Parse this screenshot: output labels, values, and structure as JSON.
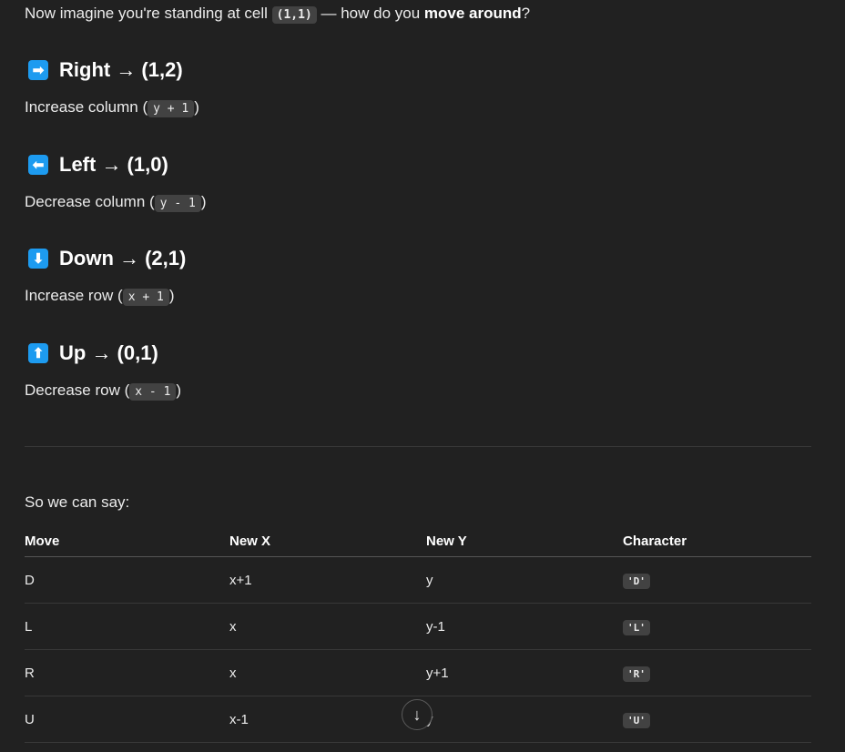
{
  "intro": {
    "before": "Now imagine you're standing at cell ",
    "cell_code": "(1,1)",
    "middle": " — how do you ",
    "bold": "move around",
    "after": "?"
  },
  "moves": [
    {
      "icon": "arrow-right-icon",
      "glyph": "➡",
      "title": "Right → (1,2)",
      "desc_before": "Increase column (",
      "code": "y + 1",
      "desc_after": ")"
    },
    {
      "icon": "arrow-left-icon",
      "glyph": "⬅",
      "title": "Left → (1,0)",
      "desc_before": "Decrease column (",
      "code": "y - 1",
      "desc_after": ")"
    },
    {
      "icon": "arrow-down-icon",
      "glyph": "⬇",
      "title": "Down → (2,1)",
      "desc_before": "Increase row (",
      "code": "x + 1",
      "desc_after": ")"
    },
    {
      "icon": "arrow-up-icon",
      "glyph": "⬆",
      "title": "Up → (0,1)",
      "desc_before": "Decrease row (",
      "code": "x - 1",
      "desc_after": ")"
    }
  ],
  "lead": "So we can say:",
  "table": {
    "headers": [
      "Move",
      "New X",
      "New Y",
      "Character"
    ],
    "rows": [
      [
        "D",
        "x+1",
        "y",
        "'D'"
      ],
      [
        "L",
        "x",
        "y-1",
        "'L'"
      ],
      [
        "R",
        "x",
        "y+1",
        "'R'"
      ],
      [
        "U",
        "x-1",
        "y",
        "'U'"
      ]
    ]
  },
  "scroll_button": {
    "icon": "arrow-down-icon",
    "glyph": "↓"
  }
}
